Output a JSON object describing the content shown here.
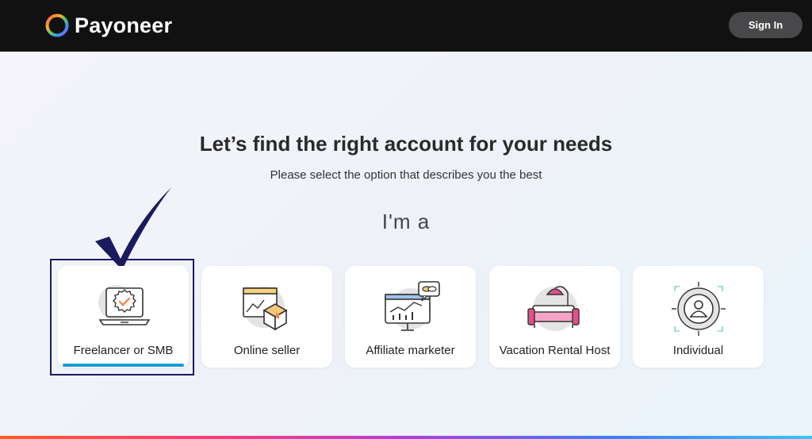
{
  "header": {
    "brand": "Payoneer",
    "logo_icon": "payoneer-ring-logo",
    "sign_in_label": "Sign In"
  },
  "main": {
    "title": "Let’s find the right account for your needs",
    "subtitle": "Please select the option that describes you the best",
    "prompt": "I'm a",
    "options": [
      {
        "label": "Freelancer or SMB",
        "icon": "laptop-badge-icon",
        "selected": true
      },
      {
        "label": "Online seller",
        "icon": "box-listing-icon",
        "selected": false
      },
      {
        "label": "Affiliate marketer",
        "icon": "monitor-chart-icon",
        "selected": false
      },
      {
        "label": "Vacation Rental Host",
        "icon": "couch-lamp-icon",
        "selected": false
      },
      {
        "label": "Individual",
        "icon": "person-target-icon",
        "selected": false
      }
    ]
  },
  "colors": {
    "topbar": "#111112",
    "signin_bg": "#48484a",
    "selection_frame": "#1c1a5e",
    "selected_underline": "#1a9ad8",
    "accent_orange": "#f08a4b",
    "accent_pink": "#e0508c"
  }
}
